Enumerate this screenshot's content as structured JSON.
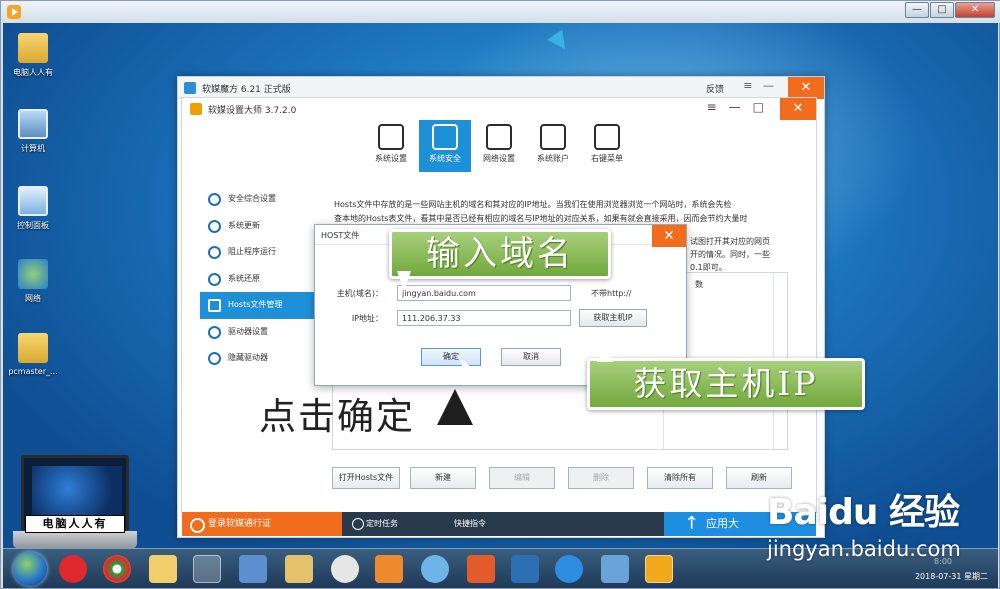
{
  "desktop": {
    "icons": [
      {
        "label": "电脑人人有"
      },
      {
        "label": "计算机"
      },
      {
        "label": "控制面板"
      },
      {
        "label": "网络"
      },
      {
        "label": "pcmaster_..."
      }
    ],
    "logo_text": "电脑人人有"
  },
  "outer_window": {
    "title": "软媒魔方 6.21 正式版",
    "feedback": "反馈",
    "close": "✕"
  },
  "app": {
    "title": "软媒设置大师 3.7.2.0",
    "close": "✕",
    "toolbar": [
      {
        "label": "系统设置",
        "icon": "monitor-gear-icon"
      },
      {
        "label": "系统安全",
        "icon": "shield-icon"
      },
      {
        "label": "网络设置",
        "icon": "network-icon"
      },
      {
        "label": "系统账户",
        "icon": "users-icon"
      },
      {
        "label": "右键菜单",
        "icon": "cursor-menu-icon"
      }
    ],
    "sidebar": [
      {
        "label": "安全综合设置"
      },
      {
        "label": "系统更新"
      },
      {
        "label": "阻止程序运行"
      },
      {
        "label": "系统还原"
      },
      {
        "label": "Hosts文件管理"
      },
      {
        "label": "驱动器设置"
      },
      {
        "label": "隐藏驱动器"
      }
    ],
    "description_line1": "Hosts文件中存放的是一些网站主机的域名和其对应的IP地址。当我们在使用浏览器浏览一个网站时，系统会先检",
    "description_line2": "查本地的Hosts表文件，看其中是否已经有相应的域名与IP地址的对应关系，如果有就会直接采用，因而会节约大量时",
    "description_right1": "试图打开其对应的网页",
    "description_right2": "开的情况。同时，一些",
    "description_right3": "0.1即可。",
    "list_header_partial": "数",
    "buttons": {
      "open_hosts": "打开Hosts文件",
      "new": "新建",
      "edit": "编辑",
      "delete": "删除",
      "clear_all": "清除所有",
      "refresh": "刷新"
    },
    "status": {
      "login": "登录软媒通行证",
      "task": "定时任务",
      "cmd": "快捷指令",
      "upgrade": "应用大"
    }
  },
  "host_dialog": {
    "title": "HOST文件",
    "host_label": "主机(域名)：",
    "host_value": "jingyan.baidu.com",
    "host_hint": "不带http://",
    "ip_label": "IP地址：",
    "ip_value": "111.206.37.33",
    "get_ip_button": "获取主机IP",
    "ok_button": "确定",
    "cancel_button": "取消"
  },
  "annotations": {
    "enter_domain": "输入域名",
    "get_ip": "获取主机IP",
    "click_ok": "点击确定"
  },
  "taskbar": {
    "date": "2018-07-31 星期二",
    "time": "8:00"
  },
  "watermark": {
    "brand": "Baidu 经验",
    "url": "jingyan.baidu.com"
  }
}
